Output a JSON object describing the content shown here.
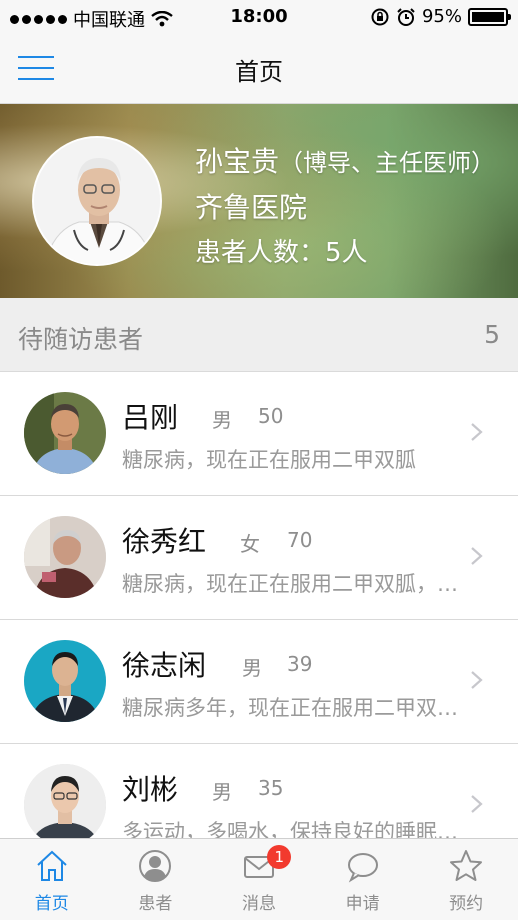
{
  "status_bar": {
    "carrier": "中国联通",
    "time": "18:00",
    "battery": "95%"
  },
  "nav": {
    "title": "首页"
  },
  "doctor": {
    "name": "孙宝贵",
    "title": "（博导、主任医师）",
    "hospital": "齐鲁医院",
    "patient_count_label": "患者人数：5人"
  },
  "section": {
    "title": "待随访患者",
    "count": "5"
  },
  "patients": [
    {
      "name": "吕刚",
      "gender": "男",
      "age": "50",
      "desc": "糖尿病，现在正在服用二甲双胍"
    },
    {
      "name": "徐秀红",
      "gender": "女",
      "age": "70",
      "desc": "糖尿病，现在正在服用二甲双胍，…"
    },
    {
      "name": "徐志闲",
      "gender": "男",
      "age": "39",
      "desc": "糖尿病多年，现在正在服用二甲双…"
    },
    {
      "name": "刘彬",
      "gender": "男",
      "age": "35",
      "desc": "多运动，多喝水，保持良好的睡眠…"
    }
  ],
  "tabs": [
    {
      "label": "首页",
      "icon": "home-icon",
      "active": true
    },
    {
      "label": "患者",
      "icon": "person-icon"
    },
    {
      "label": "消息",
      "icon": "mail-icon",
      "badge": "1"
    },
    {
      "label": "申请",
      "icon": "chat-bubble-icon"
    },
    {
      "label": "预约",
      "icon": "star-icon"
    }
  ],
  "colors": {
    "accent": "#1e88e5",
    "badge": "#f23a2e"
  }
}
